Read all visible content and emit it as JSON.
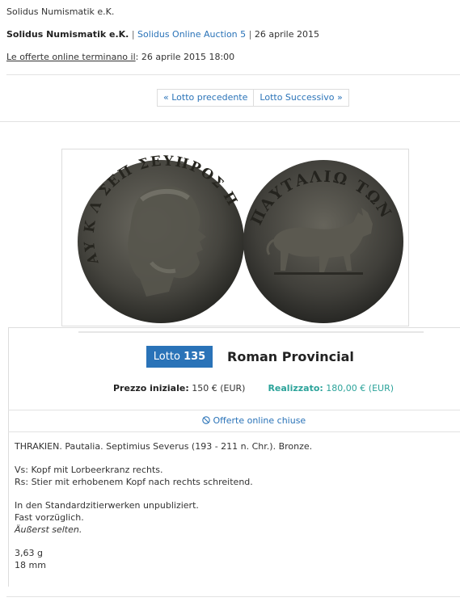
{
  "header": {
    "seller_top": "Solidus Numismatik e.K.",
    "seller_bold": "Solidus Numismatik e.K.",
    "sep1": "|",
    "auction_link": "Solidus Online Auction 5",
    "sep2": "|",
    "date": "26 aprile 2015",
    "end_label": "Le offerte online terminano il",
    "end_colon": ":",
    "end_value": "26 aprile 2015 18:00"
  },
  "pager": {
    "prev": "« Lotto precedente",
    "next": "Lotto Successivo »"
  },
  "lot": {
    "label": "Lotto",
    "number": "135",
    "title": "Roman Provincial",
    "start_price_label": "Prezzo iniziale:",
    "start_price_value": "150 € (EUR)",
    "realized_label": "Realizzato:",
    "realized_value": "180,00 € (EUR)",
    "status": "Offerte online chiuse"
  },
  "coin": {
    "obverse_legend": "ΑΥ Κ Λ ΣΕΠ ΣΕΥΗΡΟΣ Π",
    "reverse_legend": "ΠΑΥΤΑΛΙΩ ΤΩΝ"
  },
  "description": {
    "line1": "THRAKIEN. Pautalia. Septimius Severus (193 - 211 n. Chr.). Bronze.",
    "line2": "Vs: Kopf mit Lorbeerkranz rechts.",
    "line3": "Rs: Stier mit erhobenem Kopf nach rechts schreitend.",
    "line4": "In den Standardzitierwerken unpubliziert.",
    "line5": "Fast vorzüglich.",
    "line6": "Äußerst selten.",
    "line7": "3,63 g",
    "line8": "18 mm"
  },
  "colors": {
    "accent": "#2a73b8",
    "realized": "#2ba39a",
    "coin_dark": "#3a3a36"
  },
  "icons": {
    "status_icon": "ban-icon"
  }
}
